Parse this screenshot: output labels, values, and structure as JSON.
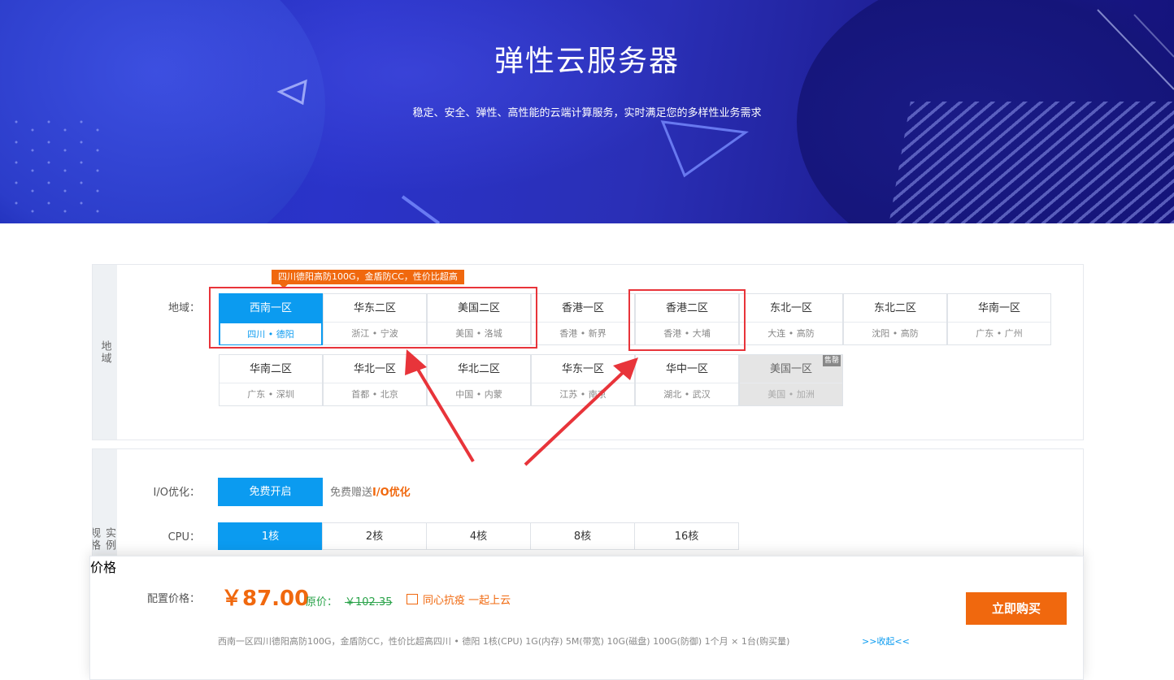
{
  "hero": {
    "title": "弹性云服务器",
    "subtitle": "稳定、安全、弹性、高性能的云端计算服务，实时满足您的多样性业务需求"
  },
  "region_panel": {
    "side_label": "地域",
    "row_label": "地域：",
    "hot_tag": "四川德阳高防100G，金盾防CC，性价比超高",
    "regions": [
      {
        "name": "西南一区",
        "loc": "四川 • 德阳",
        "state": "active"
      },
      {
        "name": "华东二区",
        "loc": "浙江 • 宁波",
        "state": "normal"
      },
      {
        "name": "美国二区",
        "loc": "美国 • 洛城",
        "state": "normal"
      },
      {
        "name": "香港一区",
        "loc": "香港 • 新界",
        "state": "normal"
      },
      {
        "name": "香港二区",
        "loc": "香港 • 大埔",
        "state": "normal"
      },
      {
        "name": "东北一区",
        "loc": "大连 • 高防",
        "state": "normal"
      },
      {
        "name": "东北二区",
        "loc": "沈阳 • 高防",
        "state": "normal"
      },
      {
        "name": "华南一区",
        "loc": "广东 • 广州",
        "state": "normal"
      },
      {
        "name": "华南二区",
        "loc": "广东 • 深圳",
        "state": "normal"
      },
      {
        "name": "华北一区",
        "loc": "首都 • 北京",
        "state": "normal"
      },
      {
        "name": "华北二区",
        "loc": "中国 • 内蒙",
        "state": "normal"
      },
      {
        "name": "华东一区",
        "loc": "江苏 • 南京",
        "state": "normal"
      },
      {
        "name": "华中一区",
        "loc": "湖北 • 武汉",
        "state": "normal"
      },
      {
        "name": "美国一区",
        "loc": "美国 • 加洲",
        "state": "disabled",
        "badge": "售罄"
      }
    ]
  },
  "instance_panel": {
    "side_label": "实例规格",
    "io_label": "I/O优化：",
    "io_button": "免费开启",
    "io_note_prefix": "免费赠送",
    "io_note_highlight": "I/O优化",
    "cpu_label": "CPU：",
    "cpu_options": [
      "1核",
      "2核",
      "4核",
      "8核",
      "16核"
    ],
    "cpu_selected": 0
  },
  "price_panel": {
    "side_label": "价格",
    "label": "配置价格：",
    "price": "￥87.00",
    "orig_label": "原价：",
    "orig_price": "￥102.35",
    "promo": "同心抗疫 一起上云",
    "buy_button": "立即购买",
    "summary": "西南一区四川德阳高防100G，金盾防CC，性价比超高四川 • 德阳  1核(CPU)  1G(内存)  5M(带宽)  10G(磁盘)  100G(防御)  1个月 × 1台(购买量)",
    "collapse": ">>收起<<"
  },
  "colors": {
    "primary": "#0b9bf0",
    "accent": "#f0680e",
    "highlight_box": "#e8343a",
    "orig_price": "#2aa34a"
  }
}
